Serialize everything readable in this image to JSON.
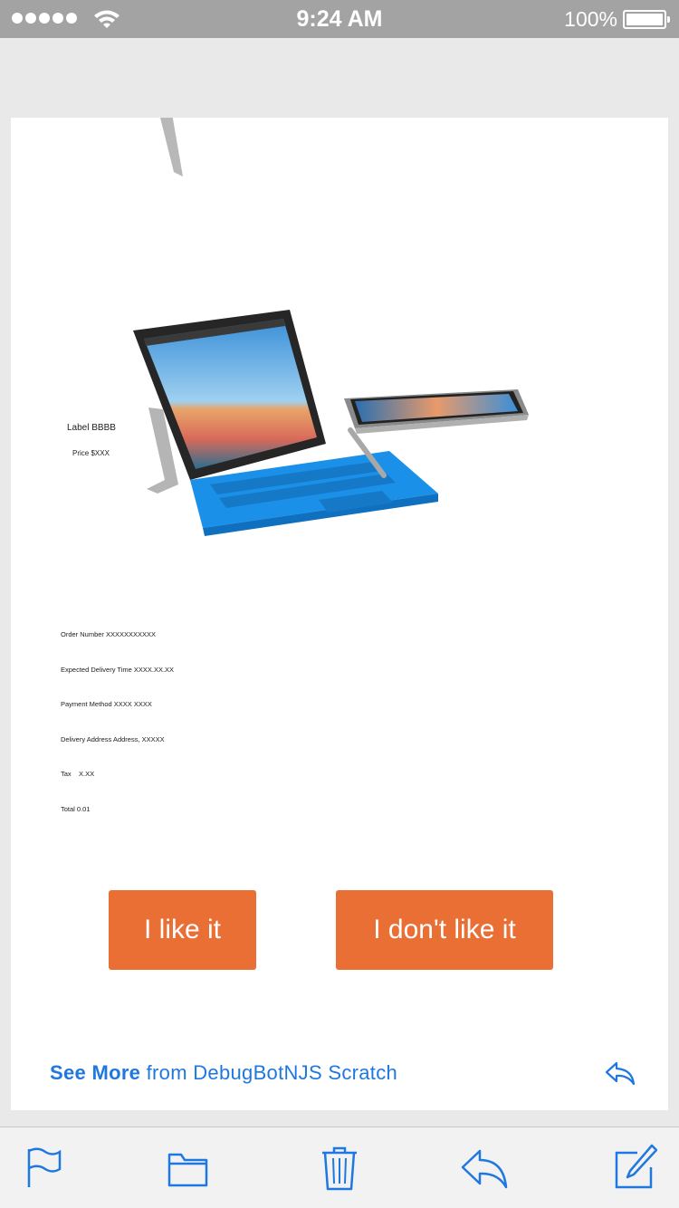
{
  "status_bar": {
    "time": "9:24 AM",
    "battery_percent": "100%",
    "signal_bars": 5,
    "icons": [
      "signal-dots-icon",
      "wifi-icon",
      "battery-icon"
    ]
  },
  "content": {
    "item_label": "Label BBBB",
    "item_price": "Price $XXX",
    "receipt": [
      "Order Number XXXXXXXXXXX",
      "Expected Delivery Time XXXX.XX.XX",
      "Payment Method XXXX XXXX",
      "Delivery Address Address, XXXXX",
      "Tax    X.XX",
      "Total 0.01"
    ],
    "buttons": {
      "like": "I like it",
      "dislike": "I don't like it"
    }
  },
  "footer": {
    "see_more": "See More",
    "from_text": " from DebugBotNJS Scratch",
    "reply_icon": "reply-icon"
  },
  "toolbar": {
    "icons": [
      "flag-icon",
      "folder-icon",
      "trash-icon",
      "reply-icon",
      "compose-icon"
    ]
  },
  "colors": {
    "accent": "#1f78e0",
    "button": "#e96f35",
    "status_bar": "#a3a3a3"
  }
}
